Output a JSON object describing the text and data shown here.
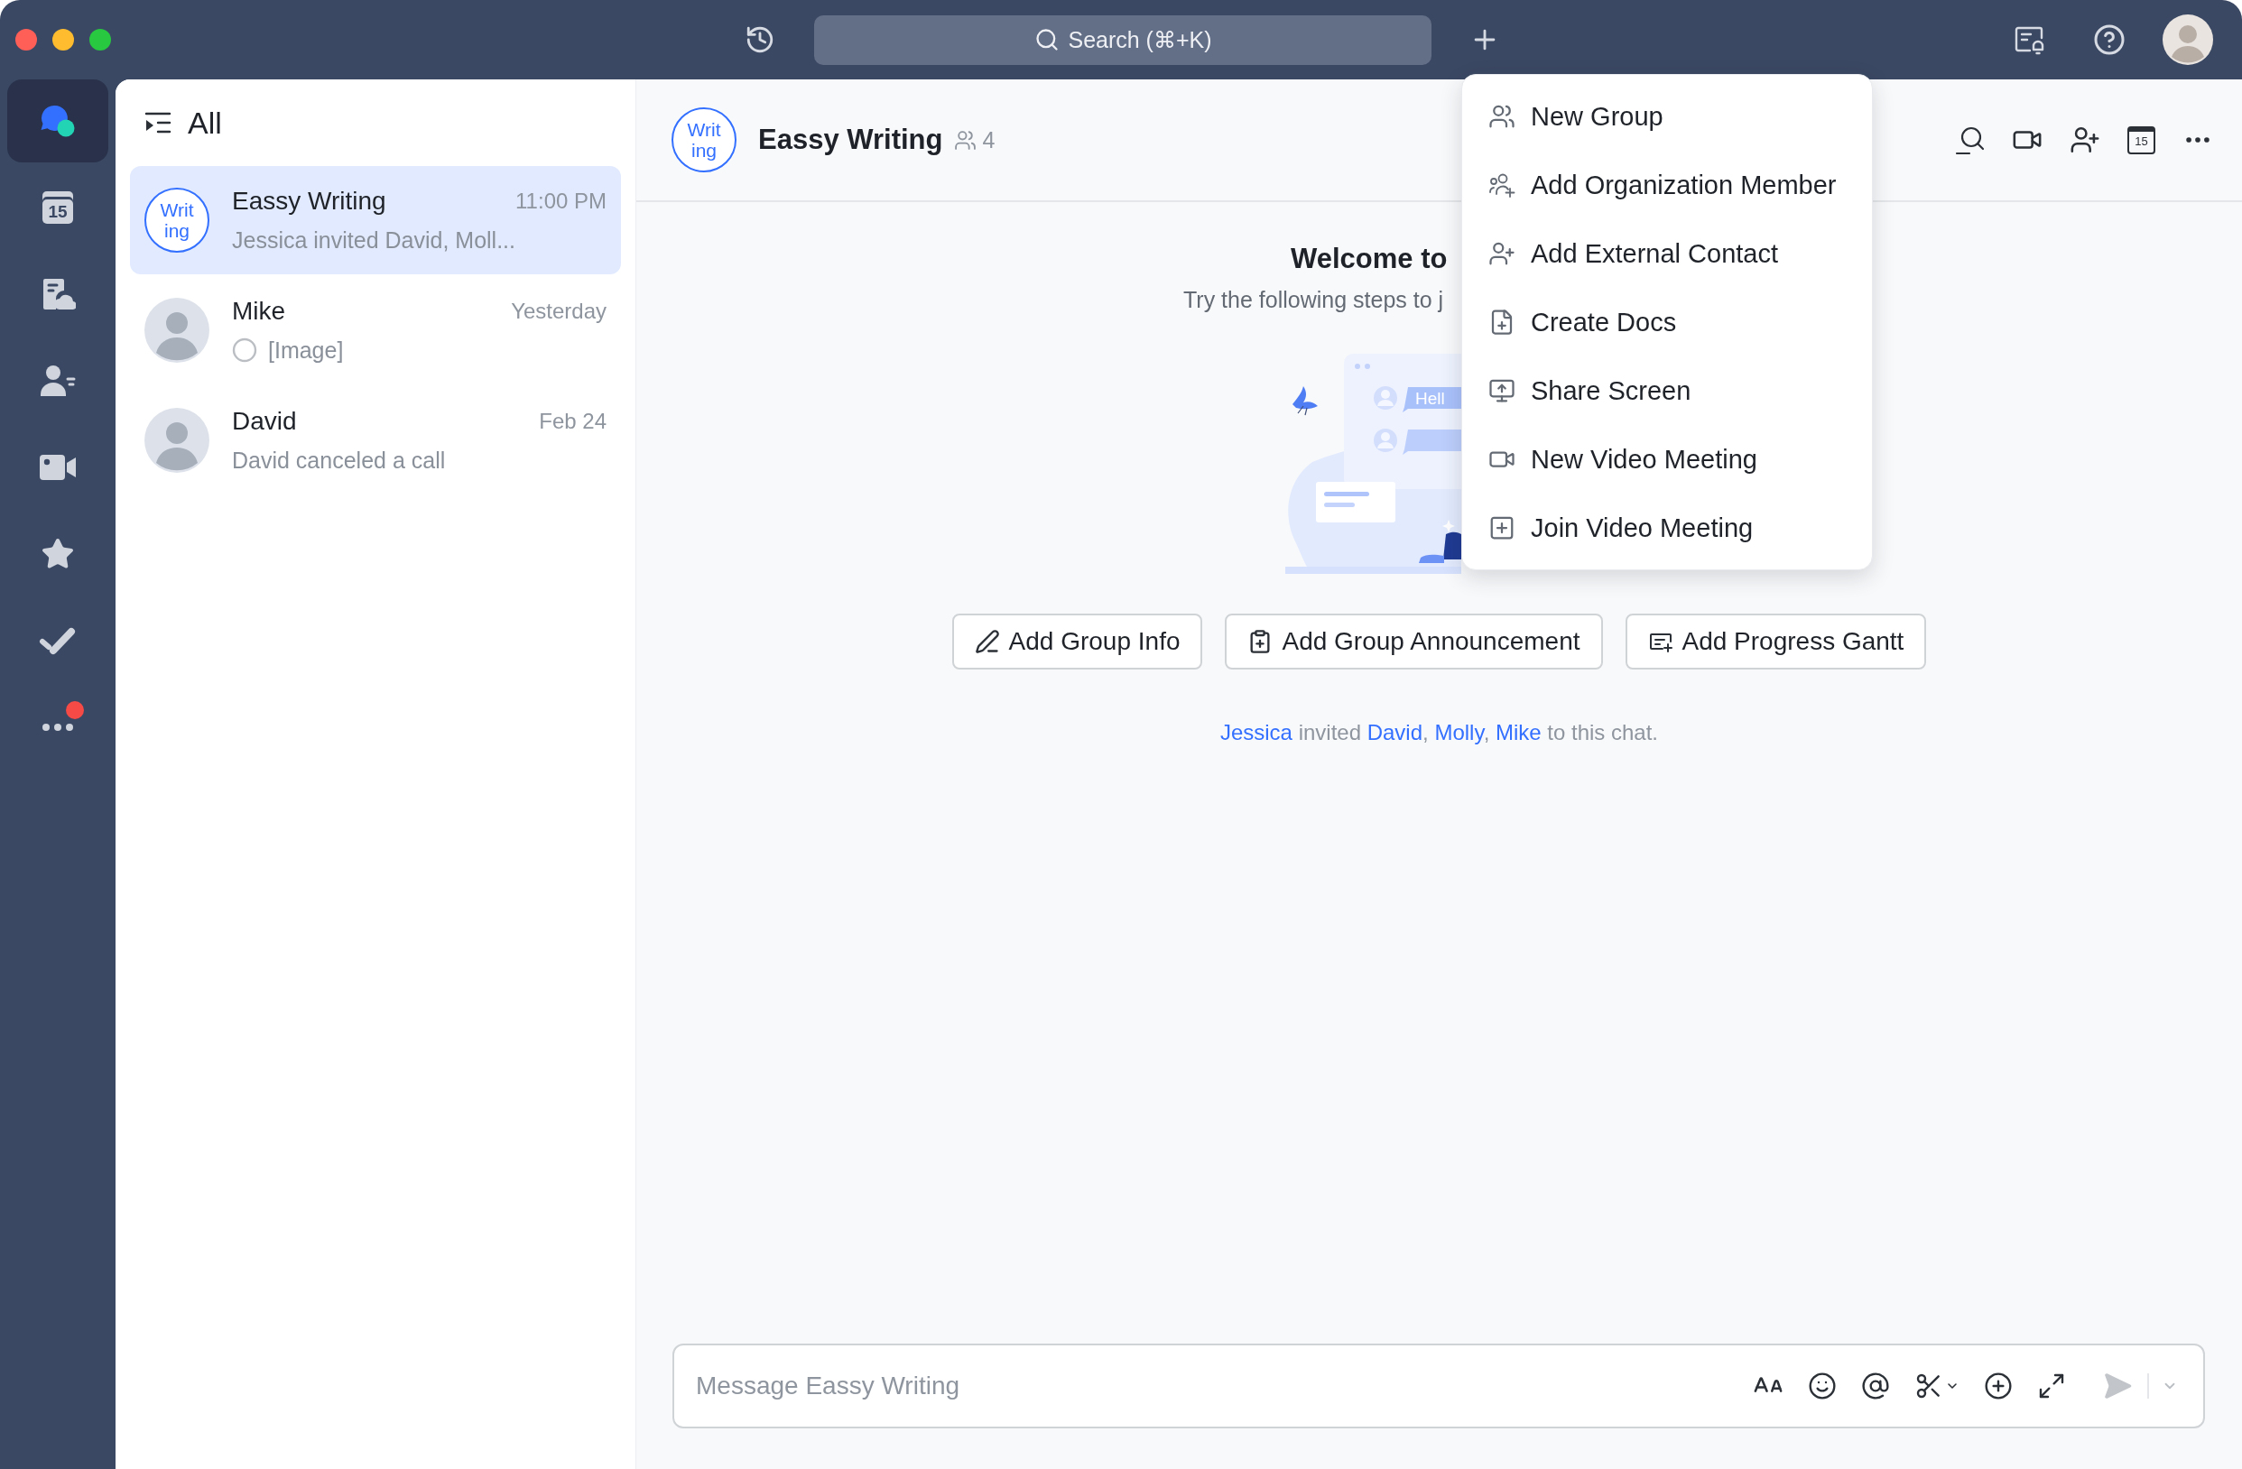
{
  "title_bar": {
    "search": {
      "placeholder": "Search (⌘+K)"
    }
  },
  "rail": {
    "items": [
      {
        "kind": "messenger",
        "selected": true,
        "unread_dot": false
      },
      {
        "kind": "calendar",
        "date": "15",
        "selected": false,
        "unread_dot": false
      },
      {
        "kind": "docs",
        "selected": false,
        "unread_dot": false
      },
      {
        "kind": "contacts",
        "selected": false,
        "unread_dot": false
      },
      {
        "kind": "meetings",
        "selected": false,
        "unread_dot": false
      },
      {
        "kind": "favorites",
        "selected": false,
        "unread_dot": false
      },
      {
        "kind": "tasks",
        "selected": false,
        "unread_dot": false
      },
      {
        "kind": "more",
        "selected": false,
        "unread_dot": true
      }
    ]
  },
  "chat_list": {
    "title": "All",
    "chats": [
      {
        "name": "Eassy Writing",
        "time": "11:00 PM",
        "preview": "Jessica invited David, Moll...",
        "selected": true,
        "receipt": false,
        "avatar": {
          "kind": "group",
          "lines": [
            "Writ",
            "ing"
          ]
        }
      },
      {
        "name": "Mike",
        "time": "Yesterday",
        "preview": "[Image]",
        "selected": false,
        "receipt": true,
        "avatar": {
          "kind": "photo"
        }
      },
      {
        "name": "David",
        "time": "Feb 24",
        "preview": "David canceled a call",
        "selected": false,
        "receipt": false,
        "avatar": {
          "kind": "photo"
        }
      }
    ]
  },
  "chat": {
    "title": "Eassy Writing",
    "avatar": {
      "kind": "group",
      "lines": [
        "Writ",
        "ing"
      ]
    },
    "member_count": "4",
    "calendar_date": "15",
    "welcome": {
      "title": "Welcome to",
      "subtitle": "Try the following steps to j",
      "bubble_text": "Hell"
    },
    "actions": [
      {
        "kind": "info",
        "label": "Add Group Info"
      },
      {
        "kind": "announcement",
        "label": "Add Group Announcement"
      },
      {
        "kind": "gantt",
        "label": "Add Progress Gantt"
      }
    ],
    "notice": [
      {
        "kind": "link",
        "text": "Jessica"
      },
      {
        "kind": "plain",
        "text": " invited "
      },
      {
        "kind": "link",
        "text": "David"
      },
      {
        "kind": "plain",
        "text": ", "
      },
      {
        "kind": "link",
        "text": "Molly"
      },
      {
        "kind": "plain",
        "text": ", "
      },
      {
        "kind": "link",
        "text": "Mike"
      },
      {
        "kind": "plain",
        "text": " to this chat."
      }
    ],
    "composer": {
      "placeholder": "Message Eassy Writing"
    }
  },
  "add_menu": {
    "open": true,
    "items": [
      {
        "kind": "new_group",
        "label": "New Group"
      },
      {
        "kind": "org_member",
        "label": "Add Organization Member"
      },
      {
        "kind": "external_contact",
        "label": "Add External Contact"
      },
      {
        "kind": "docs",
        "label": "Create Docs"
      },
      {
        "kind": "share_screen",
        "label": "Share Screen"
      },
      {
        "kind": "video_meeting",
        "label": "New Video Meeting"
      },
      {
        "kind": "join_meeting",
        "label": "Join Video Meeting"
      }
    ]
  }
}
